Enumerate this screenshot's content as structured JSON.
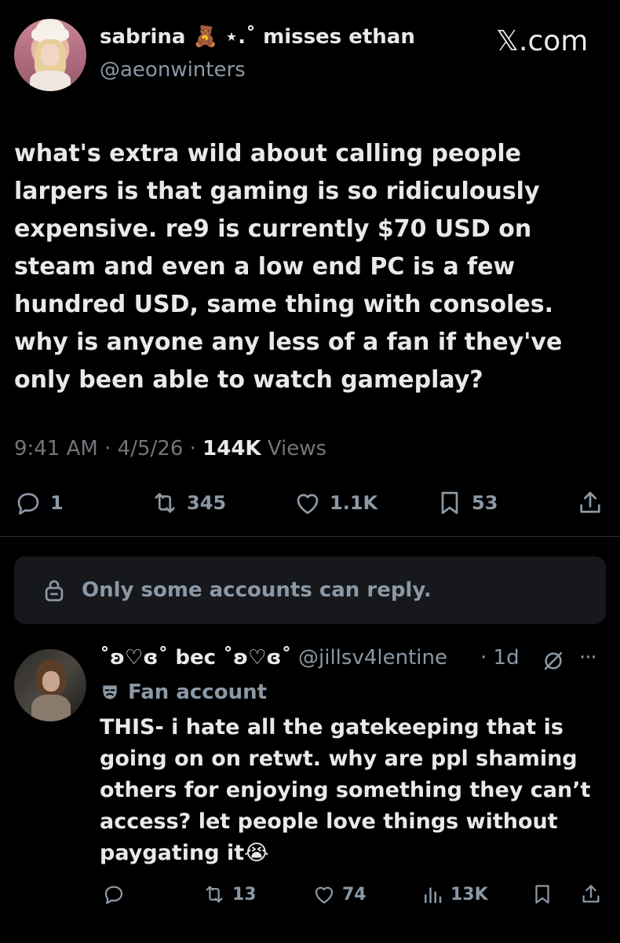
{
  "header": {
    "display_name": "sabrina 🧸 ⋆.˚ misses ethan",
    "handle": "@aeonwinters",
    "site": "𝕏.com"
  },
  "tweet": {
    "text": "what's extra wild about calling people larpers is that gaming is so ridiculously expensive. re9 is currently $70 USD on steam and even a low end PC is a few hundred USD, same thing with consoles. why is anyone any less of a fan if they've only been able to watch gameplay?",
    "time": "9:41 AM",
    "date": "4/5/26",
    "views_count": "144K",
    "views_label": "Views",
    "sep": " · "
  },
  "actions": {
    "replies": "1",
    "reposts": "345",
    "likes": "1.1K",
    "bookmarks": "53"
  },
  "banner": {
    "text": "Only some accounts can reply."
  },
  "reply": {
    "display_name": "˚ʚ♡ɞ˚ bec ˚ʚ♡ɞ˚",
    "handle": "@jillsv4lentine",
    "time": "· 1d",
    "more": "···",
    "label": "Fan account",
    "text": "THIS- i hate all the gatekeeping that is going on on retwt. why are ppl shaming others for enjoying something they can’t access? let people love things without paygating it😭",
    "reposts": "13",
    "likes": "74",
    "views": "13K"
  },
  "colors": {
    "background": "#000000",
    "text_primary": "#e7e9ea",
    "text_secondary": "#8b98a5",
    "banner_bg": "#16181c",
    "divider": "#2f3336"
  },
  "icons": [
    "reply-icon",
    "repost-icon",
    "like-icon",
    "bookmark-icon",
    "share-icon",
    "lock-icon",
    "mask-icon",
    "slash-circle-icon",
    "views-icon"
  ]
}
